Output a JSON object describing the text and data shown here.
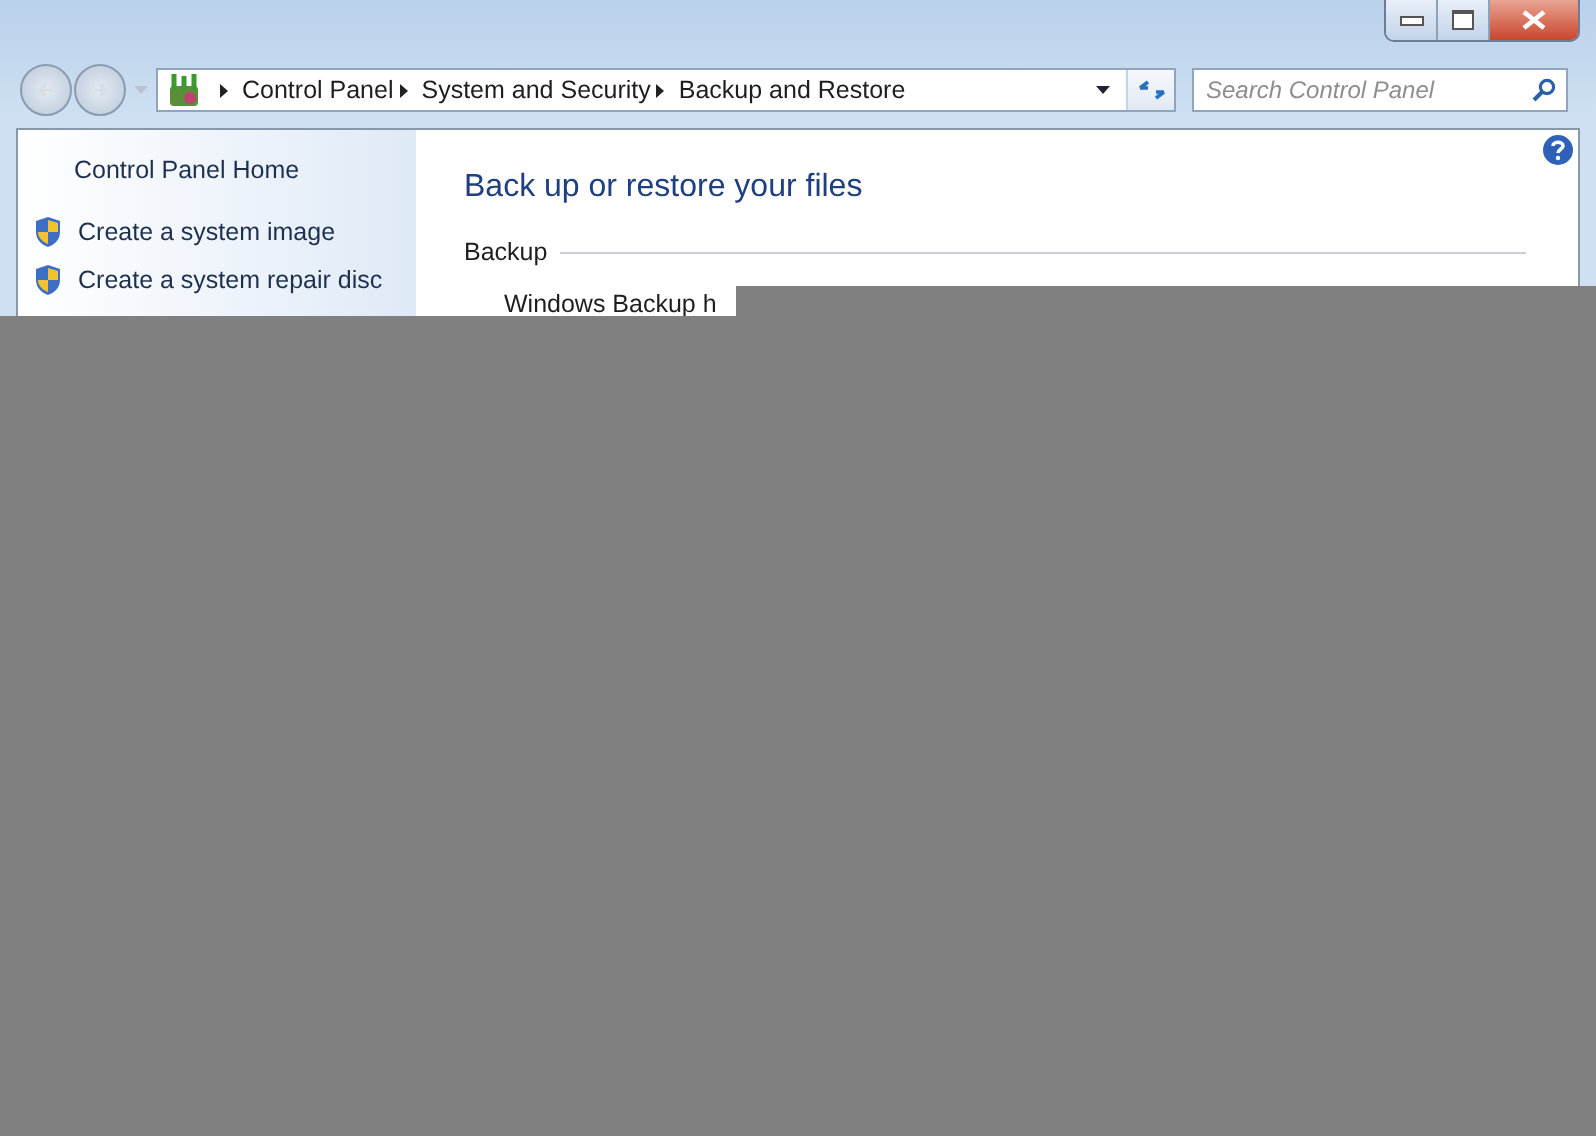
{
  "address_bar": {
    "breadcrumb": [
      "Control Panel",
      "System and Security",
      "Backup and Restore"
    ]
  },
  "search": {
    "placeholder": "Search Control Panel"
  },
  "sidebar": {
    "home": "Control Panel Home",
    "tasks": [
      "Create a system image",
      "Create a system repair disc"
    ]
  },
  "main": {
    "title": "Back up or restore your files",
    "section": "Backup",
    "status": "Windows Backup h"
  }
}
